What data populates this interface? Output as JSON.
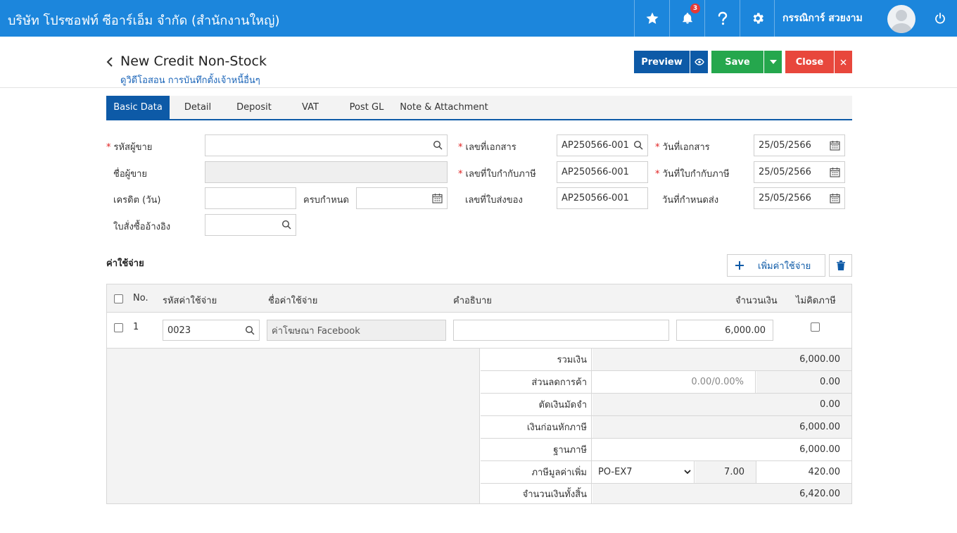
{
  "topbar": {
    "company": "บริษัท โปรซอฟท์ ซีอาร์เอ็ม จำกัด (สำนักงานใหญ่)",
    "notification_count": "3",
    "username": "กรรณิการ์ สวยงาม",
    "color": "#1c86dc"
  },
  "header": {
    "title": "New Credit Non-Stock",
    "breadcrumb": "ดูวิดีโอสอน การบันทึกตั้งเจ้าหนี้อื่นๆ",
    "preview_label": "Preview",
    "save_label": "Save",
    "close_label": "Close"
  },
  "tabs": [
    "Basic Data",
    "Detail",
    "Deposit",
    "VAT",
    "Post GL",
    "Note & Attachment"
  ],
  "form": {
    "vendor_code_label": "รหัสผู้ขาย",
    "vendor_code": "",
    "vendor_name_label": "ชื่อผู้ขาย",
    "vendor_name": "",
    "credit_days_label": "เครดิต (วัน)",
    "credit_days": "",
    "due_label": "ครบกำหนด",
    "due_date": "",
    "po_ref_label": "ใบสั่งซื้ออ้างอิง",
    "po_ref": "",
    "doc_no_label": "เลขที่เอกสาร",
    "doc_no": "AP250566-001",
    "tax_invoice_no_label": "เลขที่ใบกำกับภาษี",
    "tax_invoice_no": "AP250566-001",
    "delivery_no_label": "เลขที่ใบส่งของ",
    "delivery_no": "AP250566-001",
    "doc_date_label": "วันที่เอกสาร",
    "doc_date": "25/05/2566",
    "tax_invoice_date_label": "วันที่ใบกำกับภาษี",
    "tax_invoice_date": "25/05/2566",
    "delivery_date_label": "วันที่กำหนดส่ง",
    "delivery_date": "25/05/2566"
  },
  "expenses": {
    "title": "ค่าใช้จ่าย",
    "add_label": "เพิ่มค่าใช้จ่าย",
    "columns": {
      "no": "No.",
      "code": "รหัสค่าใช้จ่าย",
      "name": "ชื่อค่าใช้จ่าย",
      "desc": "คำอธิบาย",
      "amount": "จำนวนเงิน",
      "no_tax": "ไม่คิดภาษี"
    },
    "rows": [
      {
        "no": "1",
        "code": "0023",
        "name": "ค่าโฆษณา Facebook",
        "desc": "",
        "amount": "6,000.00",
        "no_tax": false
      }
    ]
  },
  "summary": {
    "total_label": "รวมเงิน",
    "total": "6,000.00",
    "discount_label": "ส่วนลดการค้า",
    "discount_input": "0.00/0.00%",
    "discount": "0.00",
    "deposit_label": "ตัดเงินมัดจำ",
    "deposit": "0.00",
    "before_tax_label": "เงินก่อนหักภาษี",
    "before_tax": "6,000.00",
    "tax_base_label": "ฐานภาษี",
    "tax_base": "6,000.00",
    "vat_label": "ภาษีมูลค่าเพิ่ม",
    "vat_code": "PO-EX7",
    "vat_rate": "7.00",
    "vat_amount": "420.00",
    "grand_total_label": "จำนวนเงินทั้งสิ้น",
    "grand_total": "6,420.00"
  },
  "colors": {
    "primary": "#0d5aa7",
    "save": "#25a74d",
    "close": "#e8473c"
  }
}
